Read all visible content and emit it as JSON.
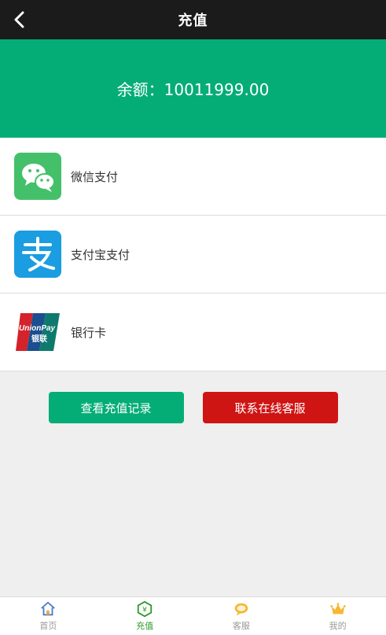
{
  "header": {
    "title": "充值"
  },
  "balance": {
    "text": "余额：10011999.00"
  },
  "methods": [
    {
      "label": "微信支付",
      "icon": "wechat-icon",
      "color": "#45c06a"
    },
    {
      "label": "支付宝支付",
      "icon": "alipay-icon",
      "color": "#1a9de1"
    },
    {
      "label": "银行卡",
      "icon": "unionpay-icon",
      "color": "#cf1414"
    }
  ],
  "actions": {
    "records_label": "查看充值记录",
    "service_label": "联系在线客服"
  },
  "tabbar": {
    "items": [
      {
        "label": "首页",
        "icon": "home-icon"
      },
      {
        "label": "充值",
        "icon": "recharge-icon",
        "active": true
      },
      {
        "label": "客服",
        "icon": "service-icon"
      },
      {
        "label": "我的",
        "icon": "crown-icon"
      }
    ]
  },
  "colors": {
    "primary": "#05ad76",
    "danger": "#cf1414",
    "header": "#1b1b1b"
  },
  "unionpay": {
    "logo_text": "UnionPay 银联"
  }
}
